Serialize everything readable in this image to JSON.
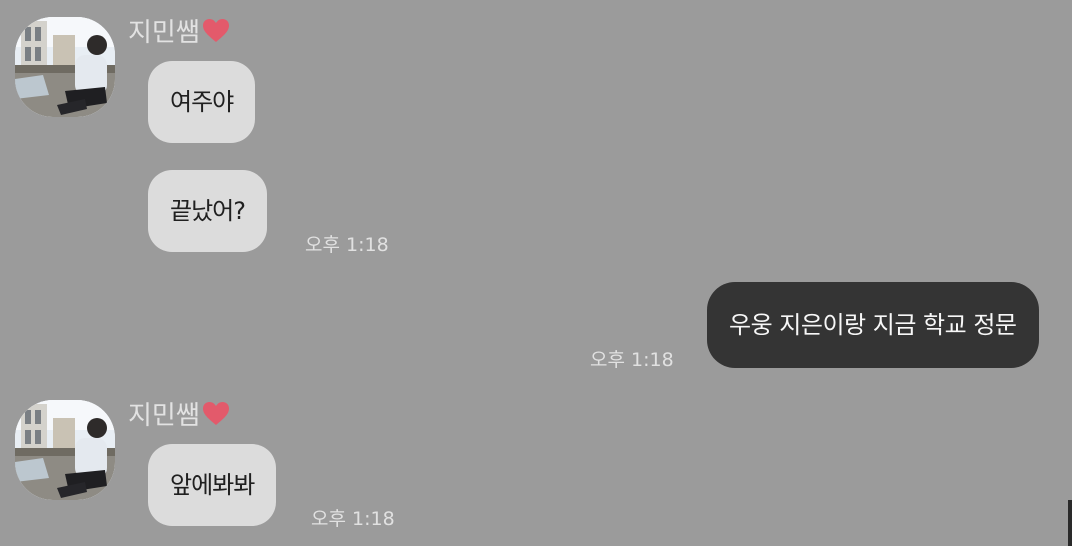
{
  "chat": {
    "messages": [
      {
        "sender": "지민쌤",
        "bubbles": [
          {
            "text": "여주야"
          },
          {
            "text": "끝났어?",
            "time": "오후 1:18"
          }
        ]
      },
      {
        "sender": "",
        "bubbles": [
          {
            "text": "우웅 지은이랑 지금 학교 정문",
            "time": "오후 1:18"
          }
        ]
      },
      {
        "sender": "지민쌤",
        "bubbles": [
          {
            "text": "앞에봐봐",
            "time": "오후 1:18"
          }
        ]
      }
    ]
  },
  "colors": {
    "background": "#9b9b9b",
    "received_bubble": "#dcdcdc",
    "sent_bubble": "#343434",
    "heart": "#e35a6b"
  },
  "icons": {
    "profile": "profile-photo-icon",
    "name_suffix": "heart-icon"
  }
}
